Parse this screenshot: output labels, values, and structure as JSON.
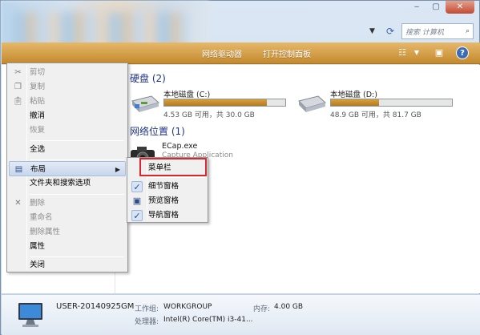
{
  "window": {
    "buttons": {
      "minimize": "‒",
      "maximize": "▢",
      "close": "✕"
    }
  },
  "address": {
    "search_placeholder": "搜索 计算机"
  },
  "toolbar": {
    "items": [
      "网络驱动器",
      "打开控制面板"
    ]
  },
  "content": {
    "drives_header": "硬盘 (2)",
    "drives": [
      {
        "name": "本地磁盘 (C:)",
        "info": "4.53 GB 可用，共 30.0 GB",
        "used_fraction": 0.85
      },
      {
        "name": "本地磁盘 (D:)",
        "info": "48.9 GB 可用，共 81.7 GB",
        "used_fraction": 0.4
      }
    ],
    "network_header": "网络位置 (1)",
    "network_items": [
      {
        "name": "ECap.exe",
        "sub": "Capture Application"
      }
    ]
  },
  "details": {
    "computer_name": "USER-20140925GM",
    "workgroup_label": "工作组:",
    "workgroup_value": "WORKGROUP",
    "memory_label": "内存:",
    "memory_value": "4.00 GB",
    "processor_label": "处理器:",
    "processor_value": "Intel(R) Core(TM) i3-41..."
  },
  "context_menu": {
    "items": [
      {
        "label": "剪切",
        "disabled": true,
        "icon": "cut-icon"
      },
      {
        "label": "复制",
        "disabled": true,
        "icon": "copy-icon"
      },
      {
        "label": "粘贴",
        "disabled": true,
        "icon": "paste-icon"
      },
      {
        "label": "撤消",
        "disabled": false
      },
      {
        "label": "恢复",
        "disabled": true
      },
      {
        "label": "全选",
        "disabled": false
      },
      {
        "label": "布局",
        "disabled": false,
        "icon": "layout-icon",
        "submenu": true,
        "highlighted": true
      },
      {
        "label": "文件夹和搜索选项",
        "disabled": false
      },
      {
        "label": "删除",
        "disabled": true,
        "icon": "delete-icon"
      },
      {
        "label": "重命名",
        "disabled": true
      },
      {
        "label": "删除属性",
        "disabled": true
      },
      {
        "label": "属性",
        "disabled": false
      },
      {
        "label": "关闭",
        "disabled": false
      }
    ]
  },
  "layout_submenu": {
    "items": [
      {
        "label": "菜单栏",
        "checked": false,
        "boxed": true
      },
      {
        "label": "细节窗格",
        "checked": true
      },
      {
        "label": "预览窗格",
        "checked": false,
        "icon": "preview-pane-icon"
      },
      {
        "label": "导航窗格",
        "checked": true
      }
    ]
  },
  "colors": {
    "accent_toolbar": "#d09a40",
    "drive_fill": "#c88c2c",
    "highlight_box": "#d6282e"
  }
}
